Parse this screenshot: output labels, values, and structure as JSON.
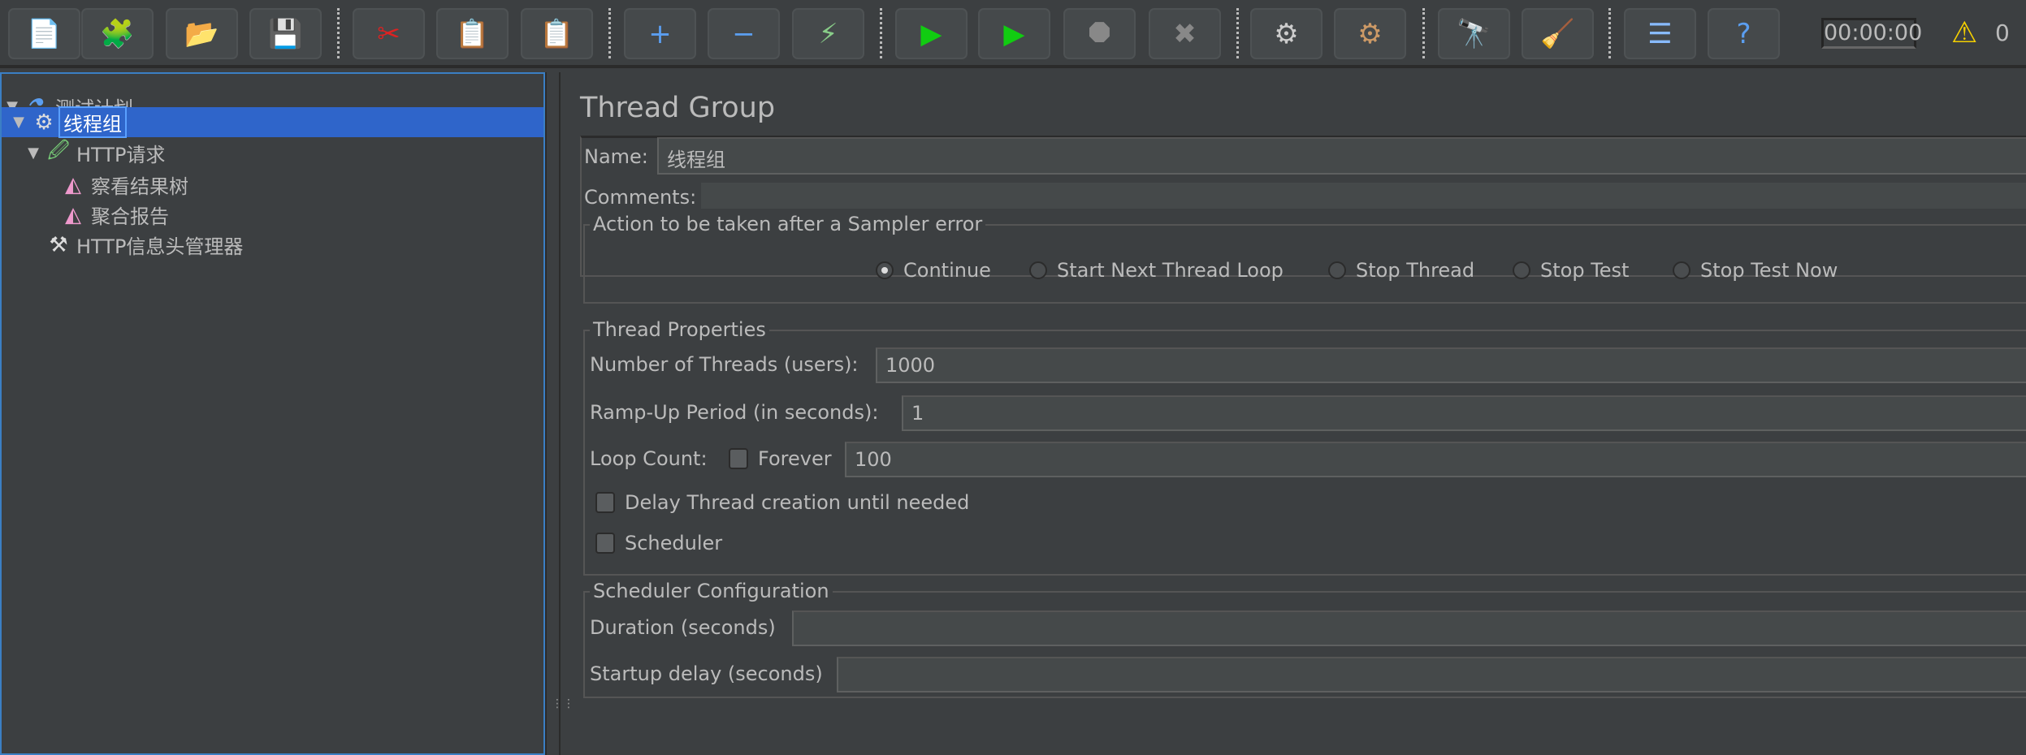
{
  "toolbar": {
    "buttons": [
      {
        "icon": "new-icon",
        "glyph": "📄"
      },
      {
        "icon": "templates-icon",
        "glyph": "🧩"
      },
      {
        "icon": "open-icon",
        "glyph": "📂"
      },
      {
        "icon": "save-icon",
        "glyph": "💾"
      },
      {
        "icon": "cut-icon",
        "glyph": "✂"
      },
      {
        "icon": "copy-icon",
        "glyph": "📋"
      },
      {
        "icon": "paste-icon",
        "glyph": "📋"
      },
      {
        "icon": "expand-icon",
        "glyph": "+"
      },
      {
        "icon": "collapse-icon",
        "glyph": "−"
      },
      {
        "icon": "toggle-icon",
        "glyph": "⚡"
      },
      {
        "icon": "start-icon",
        "glyph": "▶"
      },
      {
        "icon": "start-no-timers-icon",
        "glyph": "▶"
      },
      {
        "icon": "stop-icon",
        "glyph": "⯃"
      },
      {
        "icon": "shutdown-icon",
        "glyph": "✖"
      },
      {
        "icon": "clear-icon",
        "glyph": "⚙"
      },
      {
        "icon": "clear-all-icon",
        "glyph": "⚙"
      },
      {
        "icon": "search-icon",
        "glyph": "🔭"
      },
      {
        "icon": "reset-search-icon",
        "glyph": "🧹"
      },
      {
        "icon": "function-helper-icon",
        "glyph": "☰"
      },
      {
        "icon": "help-icon",
        "glyph": "?"
      }
    ],
    "timer": "00:00:00",
    "warning_count": "0"
  },
  "tree": {
    "items": [
      {
        "label": "测试计划",
        "icon": "test-plan-icon",
        "glyph": "⚗",
        "expanded": true
      },
      {
        "label": "线程组",
        "icon": "thread-group-gear-icon",
        "glyph": "⚙",
        "expanded": true,
        "selected": true
      },
      {
        "label": "HTTP请求",
        "icon": "sampler-pipette-icon",
        "glyph": "🖉",
        "expanded": true
      },
      {
        "label": "察看结果树",
        "icon": "listener-icon",
        "glyph": "◭"
      },
      {
        "label": "聚合报告",
        "icon": "listener-icon",
        "glyph": "◭"
      },
      {
        "label": "HTTP信息头管理器",
        "icon": "config-tools-icon",
        "glyph": "⚒"
      }
    ]
  },
  "panel": {
    "title": "Thread Group",
    "name_label": "Name:",
    "name_value": "线程组",
    "comments_label": "Comments:",
    "comments_value": "",
    "action": {
      "legend": "Action to be taken after a Sampler error",
      "options": [
        "Continue",
        "Start Next Thread Loop",
        "Stop Thread",
        "Stop Test",
        "Stop Test Now"
      ],
      "selected": "Continue"
    },
    "thread_props": {
      "legend": "Thread Properties",
      "threads_label": "Number of Threads (users):",
      "threads_value": "1000",
      "rampup_label": "Ramp-Up Period (in seconds):",
      "rampup_value": "1",
      "loop_label": "Loop Count:",
      "forever_label": "Forever",
      "forever_checked": false,
      "loop_value": "100",
      "delay_label": "Delay Thread creation until needed",
      "delay_checked": false,
      "scheduler_label": "Scheduler",
      "scheduler_checked": false
    },
    "scheduler_config": {
      "legend": "Scheduler Configuration",
      "duration_label": "Duration (seconds)",
      "duration_value": "",
      "startup_label": "Startup delay (seconds)",
      "startup_value": ""
    }
  },
  "colors": {
    "background": "#3c3f41",
    "selection": "#2f65ca",
    "field": "#45494a",
    "text": "#bbbbbb"
  }
}
